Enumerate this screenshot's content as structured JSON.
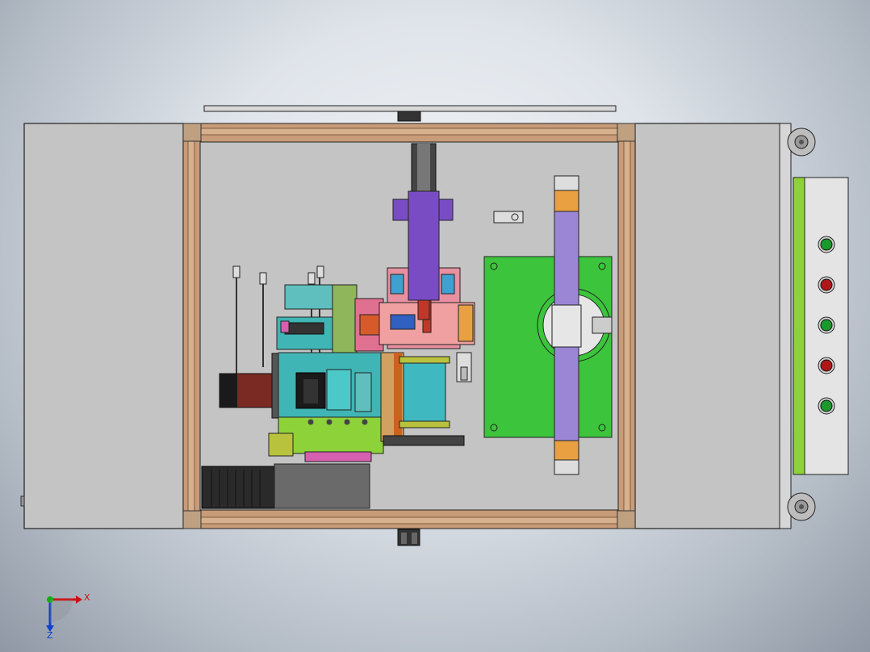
{
  "viewport": {
    "background": "gradient-gray",
    "view": "top"
  },
  "triad": {
    "x_label": "X",
    "z_label": "Z",
    "x_color": "#d01010",
    "z_color": "#1040d0",
    "origin_color": "#10b010"
  },
  "control_panel": {
    "indicators": [
      {
        "name": "indicator-1",
        "color": "#1a9a2a"
      },
      {
        "name": "indicator-2",
        "color": "#b01818"
      },
      {
        "name": "indicator-3",
        "color": "#1a9a2a"
      },
      {
        "name": "indicator-4",
        "color": "#b01818"
      },
      {
        "name": "indicator-5",
        "color": "#1a9a2a"
      }
    ],
    "side_strip_color": "#8ed23a"
  },
  "machine": {
    "frame_color": "#c89c78",
    "panel_color": "#c4c4c4",
    "fixture_plate_color": "#3cc43c",
    "gantry_color": "#9b86d6",
    "cylinder_color": "#7a4cc4"
  }
}
